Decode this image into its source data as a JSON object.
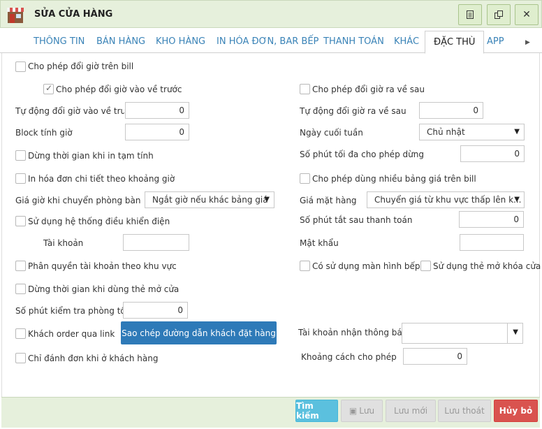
{
  "window": {
    "title": "SỬA CỬA HÀNG",
    "icons": [
      "store-icon",
      "document-icon",
      "copy-icon",
      "close-icon"
    ]
  },
  "tabs": [
    "THÔNG TIN",
    "BÁN HÀNG",
    "KHO HÀNG",
    "IN HÓA ĐƠN, BAR BẾP",
    "THANH TOÁN",
    "KHÁC",
    "ĐẶC THÙ",
    "APP"
  ],
  "active_tab": "ĐẶC THÙ",
  "left": {
    "allow_change_time": "Cho phép đổi giờ trên bill",
    "allow_change_in_earlier": "Cho phép đổi giờ vào về trước",
    "auto_change_in_earlier": "Tự động đổi giờ vào về trước",
    "auto_change_in_earlier_value": "0",
    "block_time": "Block tính giờ",
    "block_time_value": "0",
    "stop_time_on_temp_print": "Dừng thời gian khi in tạm tính",
    "print_detail_by_time": "In hóa đơn chi tiết theo khoảng giờ",
    "price_on_room_change": "Giá giờ khi chuyển phòng bàn",
    "price_on_room_change_value": "Ngắt giờ nếu khác bảng giá",
    "use_electric_control": "Sử dụng hệ thống điều khiển điện",
    "account": "Tài khoản",
    "account_value": "",
    "permission_by_area": "Phân quyền tài khoản theo khu vực",
    "stop_time_door_card": "Dừng thời gian khi dùng thẻ mở cửa",
    "max_room_check_minutes": "Số phút kiểm tra phòng tối đa",
    "max_room_check_minutes_value": "0",
    "customer_order_link": "Khách order qua link",
    "copy_link_button": "Sao chép đường dẫn khách đặt hàng",
    "only_order_at_customer": "Chỉ đánh đơn khi ở khách hàng"
  },
  "right": {
    "allow_change_out_later": "Cho phép đổi giờ ra về sau",
    "auto_change_out_later": "Tự động đổi giờ ra về sau",
    "auto_change_out_later_value": "0",
    "weekend": "Ngày cuối tuần",
    "weekend_value": "Chủ nhật",
    "max_pause_minutes": "Số phút tối đa cho phép dừng",
    "max_pause_minutes_value": "0",
    "multi_price_list": "Cho phép dùng nhiều bảng giá trên bill",
    "item_price": "Giá mặt hàng",
    "item_price_value": "Chuyển giá từ khu vực thấp lên k...",
    "off_minutes_after_pay": "Số phút tắt sau thanh toán",
    "off_minutes_after_pay_value": "0",
    "password": "Mật khẩu",
    "password_value": "",
    "use_kitchen_screen": "Có sử dụng màn hình bếp",
    "use_door_card": "Sử dụng thẻ mở khóa cửa",
    "notify_account": "Tài khoản nhận thông báo",
    "notify_account_value": "",
    "allowed_distance": "Khoảng cách cho phép",
    "allowed_distance_value": "0"
  },
  "footer": {
    "search": "Tìm kiếm",
    "save": "Lưu",
    "save_new": "Lưu mới",
    "save_exit": "Lưu thoát",
    "cancel": "Hủy bỏ"
  },
  "colors": {
    "header_bg": "#e6f0dc",
    "tab_text": "#3a83b7",
    "blue_button": "#2e7ab8",
    "search_button": "#5bc0de",
    "cancel_button": "#d9534f"
  }
}
